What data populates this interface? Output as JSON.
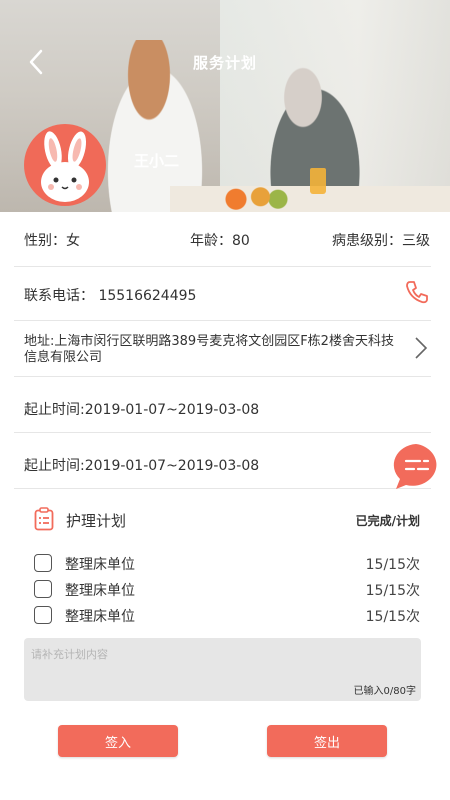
{
  "header": {
    "title": "服务计划",
    "user_name": "王小二"
  },
  "info": {
    "gender": "性别：女",
    "age": "年龄：80",
    "level": "病患级别：三级",
    "phone": "联系电话：  15516624495",
    "address": "地址:上海市闵行区联明路389号麦克将文创园区F栋2楼舍天科技信息有限公司",
    "date1": "起止时间:2019-01-07~2019-03-08",
    "date2": "起止时间:2019-01-07~2019-03-08"
  },
  "plan": {
    "title": "护理计划",
    "status": "已完成/计划",
    "tasks": [
      {
        "name": "整理床单位",
        "count": "15/15次"
      },
      {
        "name": "整理床单位",
        "count": "15/15次"
      },
      {
        "name": "整理床单位",
        "count": "15/15次"
      }
    ]
  },
  "notes": {
    "placeholder": "请补充计划内容",
    "counter": "已输入0/80字"
  },
  "actions": {
    "sign_in": "签入",
    "sign_out": "签出"
  },
  "colors": {
    "accent": "#f26b5b",
    "avatar_bg": "#f06a58",
    "notes_bg": "#e6e6e6"
  },
  "icons": [
    "back-arrow-icon",
    "phone-icon",
    "chevron-right-icon",
    "list-icon",
    "clipboard-icon",
    "checkbox-icon"
  ]
}
